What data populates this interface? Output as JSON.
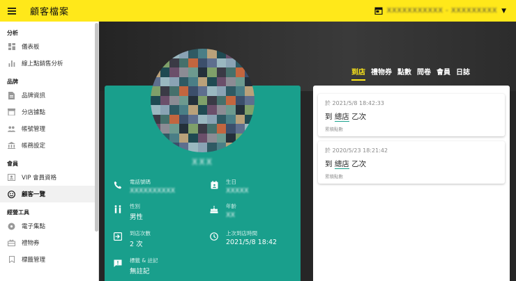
{
  "header": {
    "title": "顧客檔案",
    "store_selector": "XXXXXXXXXXX - XXXXXXXXX"
  },
  "sidebar": {
    "sections": [
      {
        "label": "分析",
        "items": [
          {
            "label": "儀表板",
            "icon": "dashboard-icon"
          },
          {
            "label": "線上點銷售分析",
            "icon": "bar-chart-icon"
          }
        ]
      },
      {
        "label": "品牌",
        "items": [
          {
            "label": "品牌資訊",
            "icon": "document-icon"
          },
          {
            "label": "分店據點",
            "icon": "store-icon"
          },
          {
            "label": "帳號管理",
            "icon": "people-icon"
          },
          {
            "label": "帳務設定",
            "icon": "bank-icon"
          }
        ]
      },
      {
        "label": "會員",
        "items": [
          {
            "label": "VIP 會員資格",
            "icon": "badge-icon"
          },
          {
            "label": "顧客一覽",
            "icon": "smiley-icon",
            "active": true
          }
        ]
      },
      {
        "label": "經營工具",
        "items": [
          {
            "label": "電子集點",
            "icon": "stamp-icon"
          },
          {
            "label": "禮物券",
            "icon": "gift-icon"
          },
          {
            "label": "標籤管理",
            "icon": "bookmark-icon"
          }
        ]
      }
    ]
  },
  "tabs": [
    {
      "label": "到店",
      "active": true
    },
    {
      "label": "禮物券"
    },
    {
      "label": "點數"
    },
    {
      "label": "問卷"
    },
    {
      "label": "會員"
    },
    {
      "label": "日誌"
    }
  ],
  "profile": {
    "name": "XXX",
    "phone_label": "電話號碼",
    "phone_value": "XXXXXXXXXX",
    "birthday_label": "生日",
    "birthday_value": "XXXXX",
    "gender_label": "性別",
    "gender_value": "男性",
    "age_label": "年齡",
    "age_value": "XX",
    "visits_label": "到店次數",
    "visits_value": "2 次",
    "last_visit_label": "上次到店時間",
    "last_visit_value": "2021/5/8 18:42",
    "tags_label": "標籤 & 註記",
    "tags_value": "無註記"
  },
  "visits": [
    {
      "time": "於 2021/5/8 18:42:33",
      "prefix": "到",
      "store": "總店",
      "suffix": "乙次",
      "note": "累積點數"
    },
    {
      "time": "於 2020/5/23 18:21:42",
      "prefix": "到",
      "store": "總店",
      "suffix": "乙次",
      "note": "累積點數"
    }
  ],
  "colors": {
    "accent": "#ffe81a",
    "teal": "#199f8c"
  }
}
